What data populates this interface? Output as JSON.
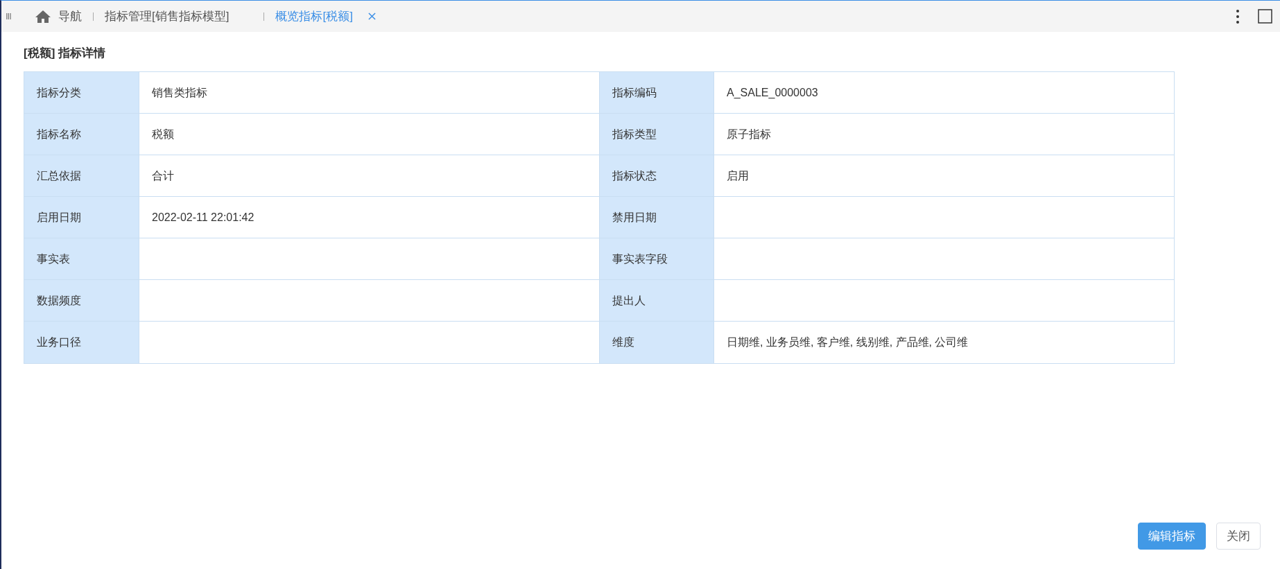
{
  "nav": {
    "menu_glyph": "III",
    "home_label": "导航",
    "tabs": [
      {
        "label": "指标管理[销售指标模型]",
        "selected": false
      },
      {
        "label": "概览指标[税额]",
        "selected": true
      }
    ]
  },
  "page": {
    "title": "[税额] 指标详情"
  },
  "table": {
    "rows": [
      [
        {
          "label": "指标分类",
          "value": "销售类指标"
        },
        {
          "label": "指标编码",
          "value": "A_SALE_0000003"
        }
      ],
      [
        {
          "label": "指标名称",
          "value": "税额"
        },
        {
          "label": "指标类型",
          "value": "原子指标"
        }
      ],
      [
        {
          "label": "汇总依据",
          "value": "合计"
        },
        {
          "label": "指标状态",
          "value": "启用"
        }
      ],
      [
        {
          "label": "启用日期",
          "value": "2022-02-11 22:01:42"
        },
        {
          "label": "禁用日期"
        }
      ],
      [
        {
          "label": "事实表"
        },
        {
          "label": "事实表字段"
        }
      ],
      [
        {
          "label": "数据频度"
        },
        {
          "label": "提出人"
        }
      ],
      [
        {
          "label": "业务口径"
        },
        {
          "label": "维度",
          "value": "日期维, 业务员维, 客户维, 线别维, 产品维, 公司维"
        }
      ]
    ]
  },
  "buttons": [
    {
      "label": "编辑指标",
      "kind": "primary"
    },
    {
      "label": "关闭",
      "kind": "default"
    }
  ]
}
